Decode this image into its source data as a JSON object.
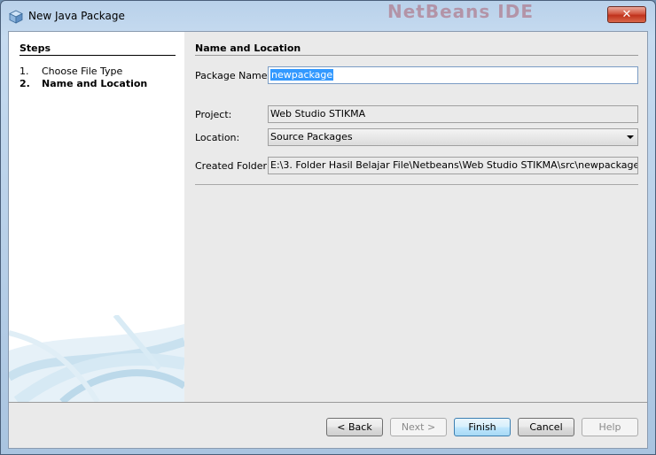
{
  "window": {
    "title": "New Java Package",
    "background_logo_text": "NetBeans IDE",
    "close_symbol": "✕"
  },
  "steps": {
    "title": "Steps",
    "items": [
      {
        "num": "1.",
        "label": "Choose File Type",
        "active": false
      },
      {
        "num": "2.",
        "label": "Name and Location",
        "active": true
      }
    ]
  },
  "panel": {
    "title": "Name and Location",
    "package_name": {
      "label": "Package Name:",
      "value": "newpackage"
    },
    "project": {
      "label": "Project:",
      "value": "Web Studio STIKMA"
    },
    "location": {
      "label": "Location:",
      "value": "Source Packages"
    },
    "created_folder": {
      "label": "Created Folder:",
      "value": "E:\\3. Folder Hasil Belajar File\\Netbeans\\Web Studio STIKMA\\src\\newpackage"
    }
  },
  "buttons": {
    "back": "< Back",
    "next": "Next >",
    "finish": "Finish",
    "cancel": "Cancel",
    "help": "Help"
  },
  "colors": {
    "selection": "#3399ff",
    "close_button": "#c0321c",
    "default_button_border": "#3c7fb1"
  }
}
